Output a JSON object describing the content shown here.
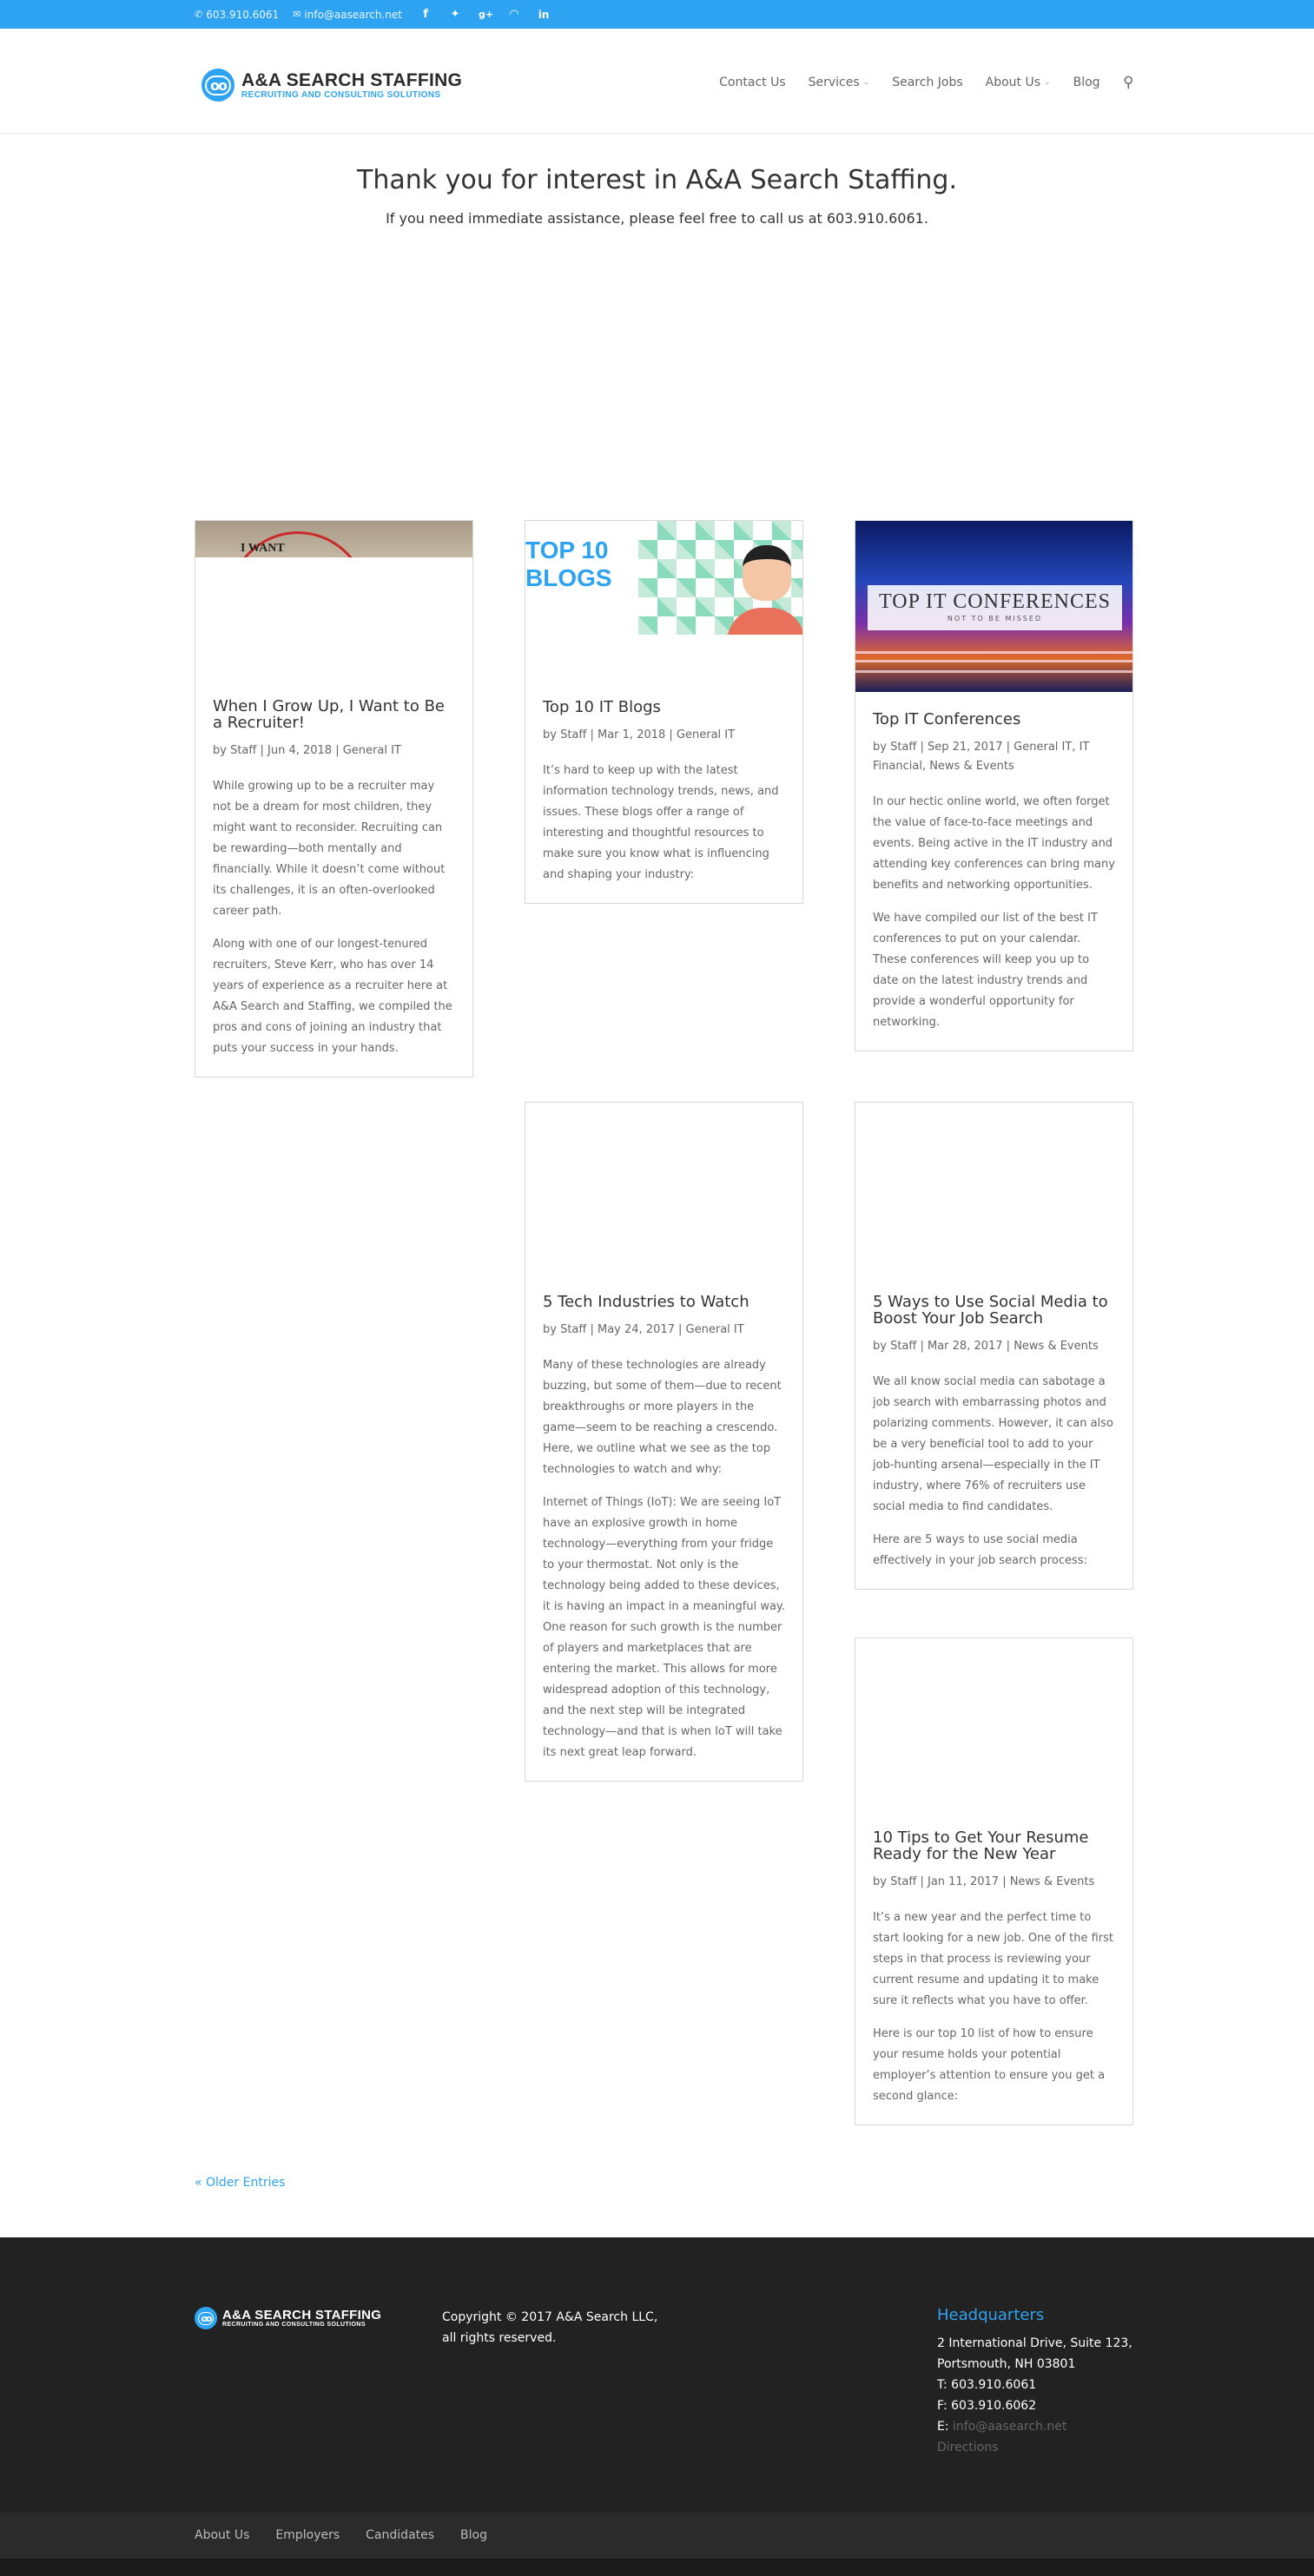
{
  "topbar": {
    "phone": "603.910.6061",
    "email": "info@aasearch.net",
    "social_icons": [
      "facebook-icon",
      "twitter-icon",
      "google-plus-icon",
      "rss-icon",
      "linkedin-icon"
    ]
  },
  "header": {
    "logo_line1": "A&A SEARCH STAFFING",
    "logo_line2": "RECRUITING AND CONSULTING SOLUTIONS",
    "logo_mark": "oo",
    "nav": [
      "Contact Us",
      "Services",
      "Search Jobs",
      "About Us",
      "Blog"
    ]
  },
  "intro": {
    "title": "Thank you for interest in A&A Search Staffing.",
    "subtitle": "If you need immediate assistance, please feel free to call us at 603.910.6061."
  },
  "thumbnails": {
    "grow": "I WANT",
    "blogs_l1": "TOP 10",
    "blogs_l2": "BLOGS",
    "conf_l1": "TOP IT CONFERENCES",
    "conf_l2": "NOT TO BE MISSED"
  },
  "posts": [
    {
      "title": "When I Grow Up, I Want to Be a Recruiter!",
      "meta": "by Staff | Jun 4, 2018 | General IT",
      "p1": "While growing up to be a recruiter may not be a dream for most children, they might want to reconsider. Recruiting can be rewarding—both mentally and financially. While it doesn’t come without its challenges, it is an often-overlooked career path.",
      "p2": "Along with one of our longest-tenured recruiters, Steve Kerr, who has over 14 years of experience as a recruiter here at A&A Search and Staffing, we compiled the pros and cons of joining an industry that puts your success in your hands."
    },
    {
      "title": "Top 10 IT Blogs",
      "meta": "by Staff | Mar 1, 2018 | General IT",
      "p1": "It’s hard to keep up with the latest information technology trends, news, and issues. These blogs offer a range of interesting and thoughtful resources to make sure you know what is influencing and shaping your industry:"
    },
    {
      "title": "Top IT Conferences",
      "meta": "by Staff | Sep 21, 2017 | General IT, IT Financial, News & Events",
      "p1": "In our hectic online world, we often forget the value of face-to-face meetings and events. Being active in the IT industry and attending key conferences can bring many benefits and networking opportunities.",
      "p2": "We have compiled our list of the best IT conferences to put on your calendar. These conferences will keep you up to date on the latest industry trends and provide a wonderful opportunity for networking."
    },
    {
      "title": "5 Tech Industries to Watch",
      "meta": "by Staff | May 24, 2017 | General IT",
      "p1": "Many of these technologies are already buzzing, but some of them—due to recent breakthroughs or more players in the game—seem to be reaching a crescendo. Here, we outline what we see as the top technologies to watch and why:",
      "p2": "Internet of Things (IoT): We are seeing IoT have an explosive growth in home technology—everything from your fridge to your thermostat. Not only is the technology being added to these devices, it is having an impact in a meaningful way. One reason for such growth is the number of players and marketplaces that are entering the market. This allows for more widespread adoption of this technology, and the next step will be integrated technology—and that is when IoT will take its next great leap forward."
    },
    {
      "title": "5 Ways to Use Social Media to Boost Your Job Search",
      "meta": "by Staff | Mar 28, 2017 | News & Events",
      "p1": "We all know social media can sabotage a job search with embarrassing photos and polarizing comments. However, it can also be a very beneficial tool to add to your job-hunting arsenal—especially in the IT industry, where 76% of recruiters use social media to find candidates.",
      "p2": "Here are 5 ways to use social media effectively in your job search process:"
    },
    {
      "title": "10 Tips to Get Your Resume Ready for the New Year",
      "meta": "by Staff | Jan 11, 2017 | News & Events",
      "p1": "It’s a new year and the perfect time to start looking for a new job. One of the first steps in that process is reviewing your current resume and updating it to make sure it reflects what you have to offer.",
      "p2": "Here is our top 10 list of how to ensure your resume holds your potential employer’s attention to ensure you get a second glance:"
    }
  ],
  "older_entries": "« Older Entries",
  "footer": {
    "copyright": "Copyright © 2017 A&A Search LLC, all rights reserved.",
    "hq_title": "Headquarters",
    "address1": "2 International Drive, Suite 123,",
    "address2": "Portsmouth, NH 03801",
    "phone": "T: 603.910.6061",
    "fax": "F: 603.910.6062",
    "email_label": "E:",
    "email": "info@aasearch.net",
    "directions": "Directions",
    "bottom_links": [
      "About Us",
      "Employers",
      "Candidates",
      "Blog"
    ]
  },
  "colors": {
    "accent": "#2ea3f2",
    "footer_bg": "#222222",
    "bottom_bar_bg": "#2b2b2b"
  }
}
